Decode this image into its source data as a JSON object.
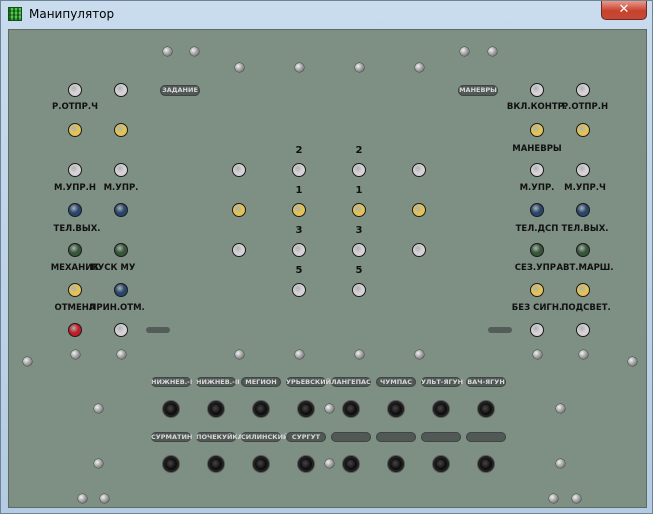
{
  "window": {
    "title": "Манипулятор",
    "close_label": "✕"
  },
  "colors": {
    "white": "#d8d2d8",
    "yellow": "#e4c257",
    "blue": "#29456e",
    "green": "#36553a",
    "red": "#c21c28"
  },
  "pills": {
    "zadanie": "ЗАДАНИЕ",
    "manevry": "МАНЕВРЫ",
    "row1": [
      "НИЖНЕВ.-I",
      "НИЖНЕВ.-II",
      "МЕГИОН",
      "УРЬЕВСКИЙ",
      "ЛАНГЕПАС",
      "ЧУМПАС",
      "УЛЬТ-ЯГУН",
      "ВАЧ-ЯГУН"
    ],
    "row2": [
      "СУРМАТИН",
      "ПОЧЕКУЙКА",
      "СИЛИНСКИЙ",
      "СУРГУТ",
      "",
      "",
      "",
      ""
    ]
  },
  "left": {
    "r1": [
      "Р.ОТПР.Ч",
      "",
      ""
    ],
    "r3": [
      "М.УПР.Н",
      "М.УПР."
    ],
    "r4": [
      "ТЕЛ.ВЫХ."
    ],
    "r5": [
      "МЕХАНИК",
      "ПУСК МУ"
    ],
    "r6": [
      "ОТМЕНА",
      "ПРИН.ОТМ."
    ]
  },
  "right": {
    "r1": [
      "ВКЛ.КОНТР.",
      "Р.ОТПР.Н"
    ],
    "r2": [
      "МАНЕВРЫ"
    ],
    "r3": [
      "М.УПР.",
      "М.УПР.Ч"
    ],
    "r4": [
      "ТЕЛ.ДСП",
      "ТЕЛ.ВЫХ."
    ],
    "r5": [
      "СЕЗ.УПР.",
      "АВТ.МАРШ."
    ],
    "r6": [
      "БЕЗ СИГН.",
      "ПОДСВЕТ."
    ]
  },
  "center": {
    "numbers": [
      "2",
      "2",
      "1",
      "1",
      "3",
      "3",
      "5",
      "5"
    ]
  }
}
